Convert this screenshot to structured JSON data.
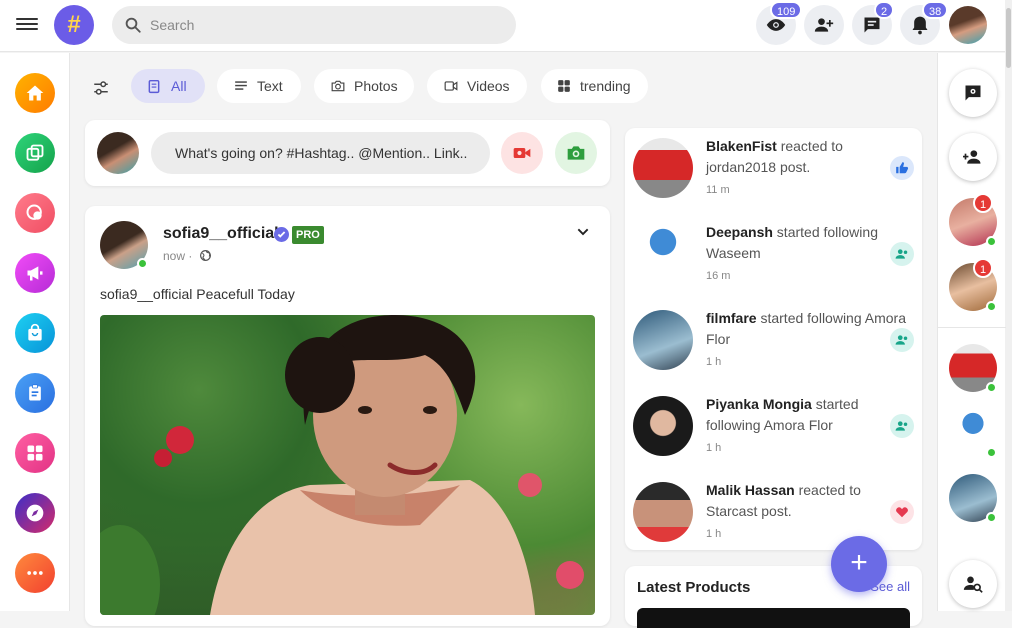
{
  "header": {
    "search_placeholder": "Search",
    "badges": {
      "views": "109",
      "messages": "2",
      "notifications": "38"
    }
  },
  "filters": [
    {
      "label": "All",
      "active": true
    },
    {
      "label": "Text"
    },
    {
      "label": "Photos"
    },
    {
      "label": "Videos"
    },
    {
      "label": "trending"
    }
  ],
  "composer": {
    "placeholder": "What's going on? #Hashtag.. @Mention.. Link.."
  },
  "post": {
    "author": "sofia9__official",
    "badge": "PRO",
    "time": "now",
    "text": "sofia9__official Peacefull Today"
  },
  "notifications": [
    {
      "name": "BlakenFist",
      "action": " reacted to jordan2018 post.",
      "time": "11 m",
      "icon": "like-icon"
    },
    {
      "name": "Deepansh",
      "action": " started following Waseem",
      "time": "16 m",
      "icon": "follow-icon"
    },
    {
      "name": "filmfare",
      "action": " started following Amora Flor",
      "time": "1 h",
      "icon": "follow-icon"
    },
    {
      "name": "Piyanka Mongia",
      "action": " started following Amora Flor",
      "time": "1 h",
      "icon": "follow-icon"
    },
    {
      "name": "Malik Hassan",
      "action": " reacted to Starcast post.",
      "time": "1 h",
      "icon": "love-icon"
    }
  ],
  "products": {
    "title": "Latest Products",
    "see_all": "See all"
  },
  "rightbar": {
    "badge_1": "1",
    "badge_2": "1"
  },
  "colors": {
    "accent": "#6b6be6",
    "pro": "#3a8a2f",
    "online": "#3bc23b",
    "alert": "#e53935"
  }
}
